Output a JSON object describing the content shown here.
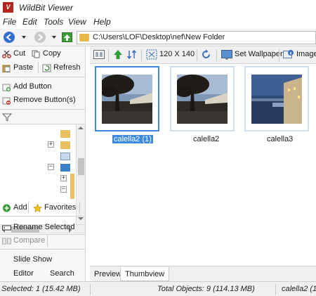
{
  "window": {
    "title": "WildBit Viewer",
    "logo_text": "V"
  },
  "menu": [
    "File",
    "Edit",
    "Tools",
    "View",
    "Help"
  ],
  "address": {
    "path": "C:\\Users\\LOF\\Desktop\\nef\\New Folder"
  },
  "left_panel": {
    "cut": "Cut",
    "copy": "Copy",
    "paste": "Paste",
    "refresh": "Refresh",
    "add_button": "Add Button",
    "remove_buttons": "Remove Button(s)",
    "add": "Add",
    "favorites": "Favorites",
    "rename_selected": "Rename Selected",
    "compare": "Compare",
    "slide_show": "Slide Show",
    "editor": "Editor",
    "search": "Search"
  },
  "toolbar": {
    "size_label": "120 X 140",
    "set_wallpaper": "Set Wallpaper",
    "image_info": "Image I"
  },
  "thumbnails": [
    {
      "label": "calella2 (1)",
      "selected": true
    },
    {
      "label": "calella2",
      "selected": false
    },
    {
      "label": "calella3",
      "selected": false
    }
  ],
  "tabs": [
    "Preview",
    "Thumbview"
  ],
  "active_tab": "Thumbview",
  "status": {
    "selected": "Selected: 1 (15.42 MB)",
    "total": "Total Objects: 9 (114.13 MB)",
    "current": "calella2 (1"
  },
  "colors": {
    "accent": "#3c8ae0",
    "logo": "#b3261e",
    "folder": "#e8b84a"
  }
}
